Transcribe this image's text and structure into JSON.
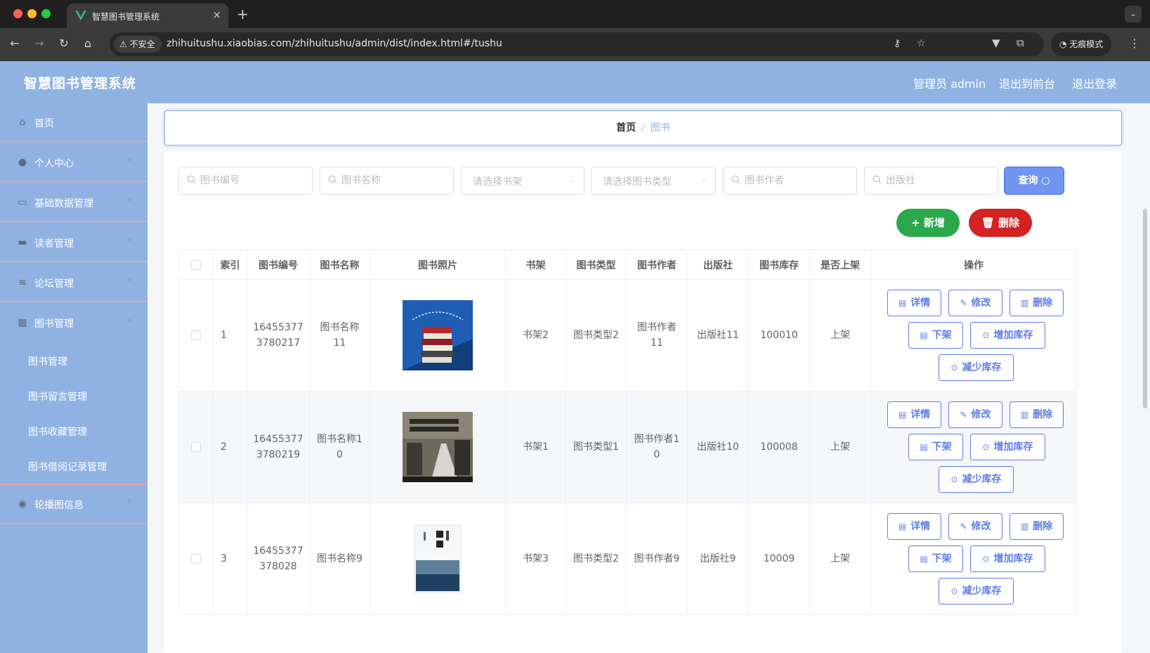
{
  "browser": {
    "tab_title": "智慧图书管理系统",
    "new_tab": "+",
    "security_label": "不安全",
    "url": "zhihuitushu.xiaobias.com/zhihuitushu/admin/dist/index.html#/tushu",
    "incognito_label": "无痕模式"
  },
  "header": {
    "title": "智慧图书管理系统",
    "user": "管理员 admin",
    "to_front": "退出到前台",
    "logout": "退出登录"
  },
  "sidebar": {
    "items": [
      {
        "label": "首页",
        "icon": "home-icon"
      },
      {
        "label": "个人中心",
        "icon": "user-icon"
      },
      {
        "label": "基础数据管理",
        "icon": "chat-icon"
      },
      {
        "label": "读者管理",
        "icon": "briefcase-icon"
      },
      {
        "label": "论坛管理",
        "icon": "list-icon"
      },
      {
        "label": "图书管理",
        "icon": "grid-icon"
      },
      {
        "label": "轮播图信息",
        "icon": "bulb-icon"
      }
    ],
    "sub_items": [
      "图书管理",
      "图书留言管理",
      "图书收藏管理",
      "图书借阅记录管理"
    ]
  },
  "breadcrumb": {
    "home": "首页",
    "sep": "/",
    "current": "图书"
  },
  "search": {
    "code_placeholder": "图书编号",
    "name_placeholder": "图书名称",
    "shelf_placeholder": "请选择书架",
    "type_placeholder": "请选择图书类型",
    "author_placeholder": "图书作者",
    "publisher_placeholder": "出版社",
    "query_label": "查询"
  },
  "actions": {
    "add_label": "新增",
    "delete_label": "删除"
  },
  "table": {
    "headers": [
      "索引",
      "图书编号",
      "图书名称",
      "图书照片",
      "书架",
      "图书类型",
      "图书作者",
      "出版社",
      "图书库存",
      "是否上架",
      "操作"
    ],
    "rows": [
      {
        "index": "1",
        "code": "164553773780217",
        "name": "图书名称11",
        "shelf": "书架2",
        "type": "图书类型2",
        "author": "图书作者11",
        "publisher": "出版社11",
        "stock": "100010",
        "listed": "上架"
      },
      {
        "index": "2",
        "code": "164553773780219",
        "name": "图书名称10",
        "shelf": "书架1",
        "type": "图书类型1",
        "author": "图书作者10",
        "publisher": "出版社10",
        "stock": "100008",
        "listed": "上架"
      },
      {
        "index": "3",
        "code": "16455377378028",
        "name": "图书名称9",
        "shelf": "书架3",
        "type": "图书类型2",
        "author": "图书作者9",
        "publisher": "出版社9",
        "stock": "10009",
        "listed": "上架"
      }
    ],
    "op_labels": {
      "detail": "详情",
      "edit": "修改",
      "delete": "删除",
      "unlist": "下架",
      "add_stock": "增加库存",
      "reduce_stock": "减少库存"
    }
  },
  "colors": {
    "accent": "#8fb2e2",
    "primary": "#5d7de8",
    "add": "#2aa84a",
    "danger": "#d42121"
  }
}
